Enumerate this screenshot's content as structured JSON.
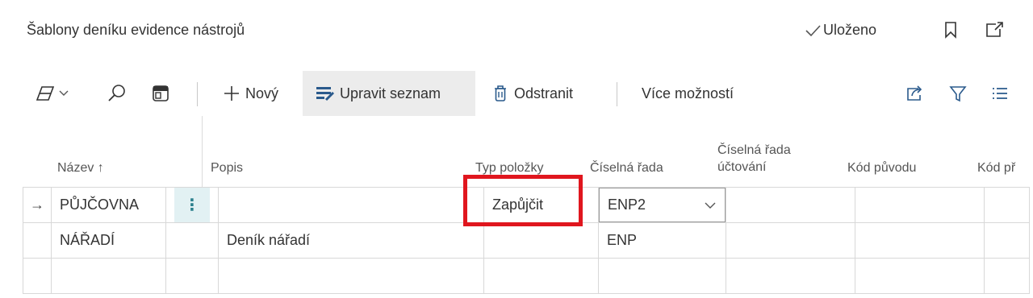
{
  "page": {
    "title": "Šablony deníku evidence nástrojů",
    "saved_label": "Uloženo",
    "icons": [
      "bookmark-icon",
      "open-new-window-icon"
    ]
  },
  "toolbar": {
    "new_label": "Nový",
    "edit_list_label": "Upravit seznam",
    "delete_label": "Odstranit",
    "more_label": "Více možností",
    "icons": [
      "analysis-mode-icon",
      "search-icon",
      "filter-pane-icon",
      "share-icon",
      "filter-icon",
      "list-view-icon"
    ]
  },
  "columns": {
    "name": "Název ↑",
    "desc": "Popis",
    "item_type": "Typ položky",
    "no_series": "Číselná řada",
    "posting_no_series_line1": "Číselná řada",
    "posting_no_series_line2": "účtování",
    "source_code": "Kód původu",
    "reason_code": "Kód př"
  },
  "rows": [
    {
      "marker": "→",
      "name": "PŮJČOVNA",
      "desc": "",
      "item_type": "Zapůjčit",
      "no_series": "ENP2",
      "posting_no_series": "",
      "source_code": "",
      "reason_code": ""
    },
    {
      "marker": "",
      "name": "NÁŘADÍ",
      "desc": "Deník nářadí",
      "item_type": "",
      "no_series": "ENP",
      "posting_no_series": "",
      "source_code": "",
      "reason_code": ""
    }
  ],
  "colors": {
    "accent": "#2a7f8c",
    "highlight": "#e0161e",
    "active_bg": "#ececec"
  }
}
